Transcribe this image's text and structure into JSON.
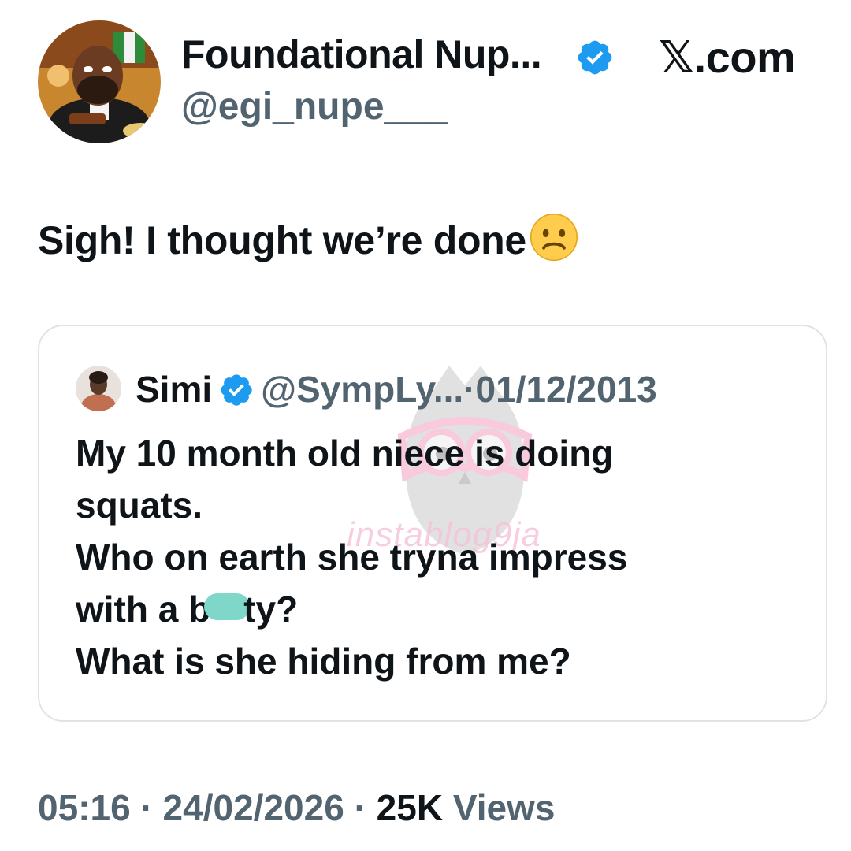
{
  "author": {
    "name": "Foundational Nup...",
    "handle": "@egi_nupe___",
    "verified": true,
    "avatar": "caricature-judge-avatar"
  },
  "brand": "𝕏.com",
  "tweet": {
    "text": "Sigh! I thought we’re done",
    "emoji": "frowning-face-icon"
  },
  "quoted_tweet": {
    "name": "Simi",
    "handle": "@SympLy...",
    "separator": "·",
    "date": "01/12/2013",
    "verified": true,
    "lines": [
      "My 10 month old niece is doing",
      "squats.",
      "Who on earth she tryna impress"
    ],
    "censored_line_start": "with a b",
    "censored_line_end": "ty?",
    "last_line": "What is she hiding from me?",
    "watermark": "instablog9ja"
  },
  "footer": {
    "time": "05:16",
    "sep1": "·",
    "date": "24/02/2026",
    "sep2": "·",
    "views_count": "25K",
    "views_label": "Views"
  },
  "colors": {
    "verified": "#1d9bf0",
    "muted": "#536471",
    "text": "#0f1419",
    "border": "#dfe3e6",
    "censor": "#7fd7c9"
  }
}
